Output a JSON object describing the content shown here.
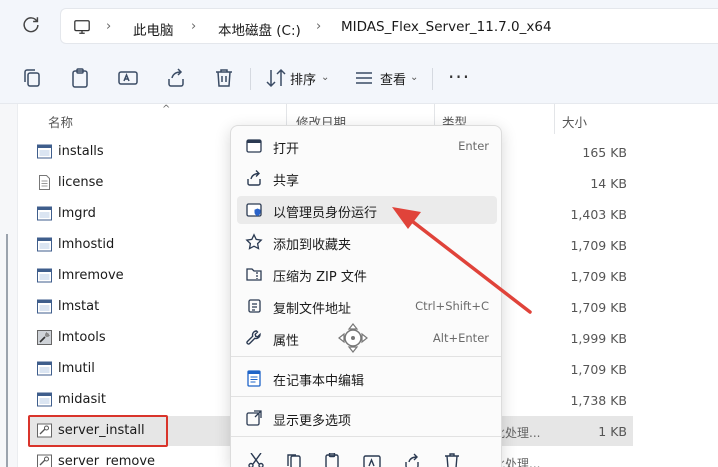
{
  "breadcrumbs": [
    "此电脑",
    "本地磁盘 (C:)",
    "MIDAS_Flex_Server_11.7.0_x64"
  ],
  "toolbar": {
    "sort_label": "排序",
    "view_label": "查看"
  },
  "columns": {
    "name": "名称",
    "date": "修改日期",
    "type": "类型",
    "size": "大小"
  },
  "files": [
    {
      "name": "installs",
      "size": "165 KB",
      "icon": "window-exe-icon"
    },
    {
      "name": "license",
      "size": "14 KB",
      "icon": "text-file-icon"
    },
    {
      "name": "lmgrd",
      "size": "1,403 KB",
      "icon": "window-exe-icon"
    },
    {
      "name": "lmhostid",
      "size": "1,709 KB",
      "icon": "window-exe-icon"
    },
    {
      "name": "lmremove",
      "size": "1,709 KB",
      "icon": "window-exe-icon"
    },
    {
      "name": "lmstat",
      "size": "1,709 KB",
      "icon": "window-exe-icon"
    },
    {
      "name": "lmtools",
      "size": "1,999 KB",
      "icon": "tools-exe-icon"
    },
    {
      "name": "lmutil",
      "size": "1,709 KB",
      "icon": "window-exe-icon"
    },
    {
      "name": "midasit",
      "size": "1,738 KB",
      "icon": "window-exe-icon"
    },
    {
      "name": "server_install",
      "type": "批处理...",
      "size": "1 KB",
      "icon": "batch-file-icon"
    },
    {
      "name": "server_remove",
      "type": "批处理...",
      "size": "",
      "icon": "batch-file-icon"
    }
  ],
  "context_menu": {
    "items": [
      {
        "label": "打开",
        "shortcut": "Enter",
        "icon": "open-window-icon"
      },
      {
        "label": "共享",
        "shortcut": "",
        "icon": "share-icon"
      },
      {
        "label": "以管理员身份运行",
        "shortcut": "",
        "icon": "shield-icon"
      },
      {
        "label": "添加到收藏夹",
        "shortcut": "",
        "icon": "star-icon"
      },
      {
        "label": "压缩为 ZIP 文件",
        "shortcut": "",
        "icon": "zip-icon"
      },
      {
        "label": "复制文件地址",
        "shortcut": "Ctrl+Shift+C",
        "icon": "copy-path-icon"
      },
      {
        "label": "属性",
        "shortcut": "Alt+Enter",
        "icon": "wrench-icon"
      },
      {
        "label": "在记事本中编辑",
        "shortcut": "",
        "icon": "notepad-icon"
      },
      {
        "label": "显示更多选项",
        "shortcut": "",
        "icon": "more-options-icon"
      }
    ]
  },
  "colors": {
    "highlight_border": "#d9342b",
    "arrow": "#e0433a",
    "hover": "#ebebeb"
  }
}
